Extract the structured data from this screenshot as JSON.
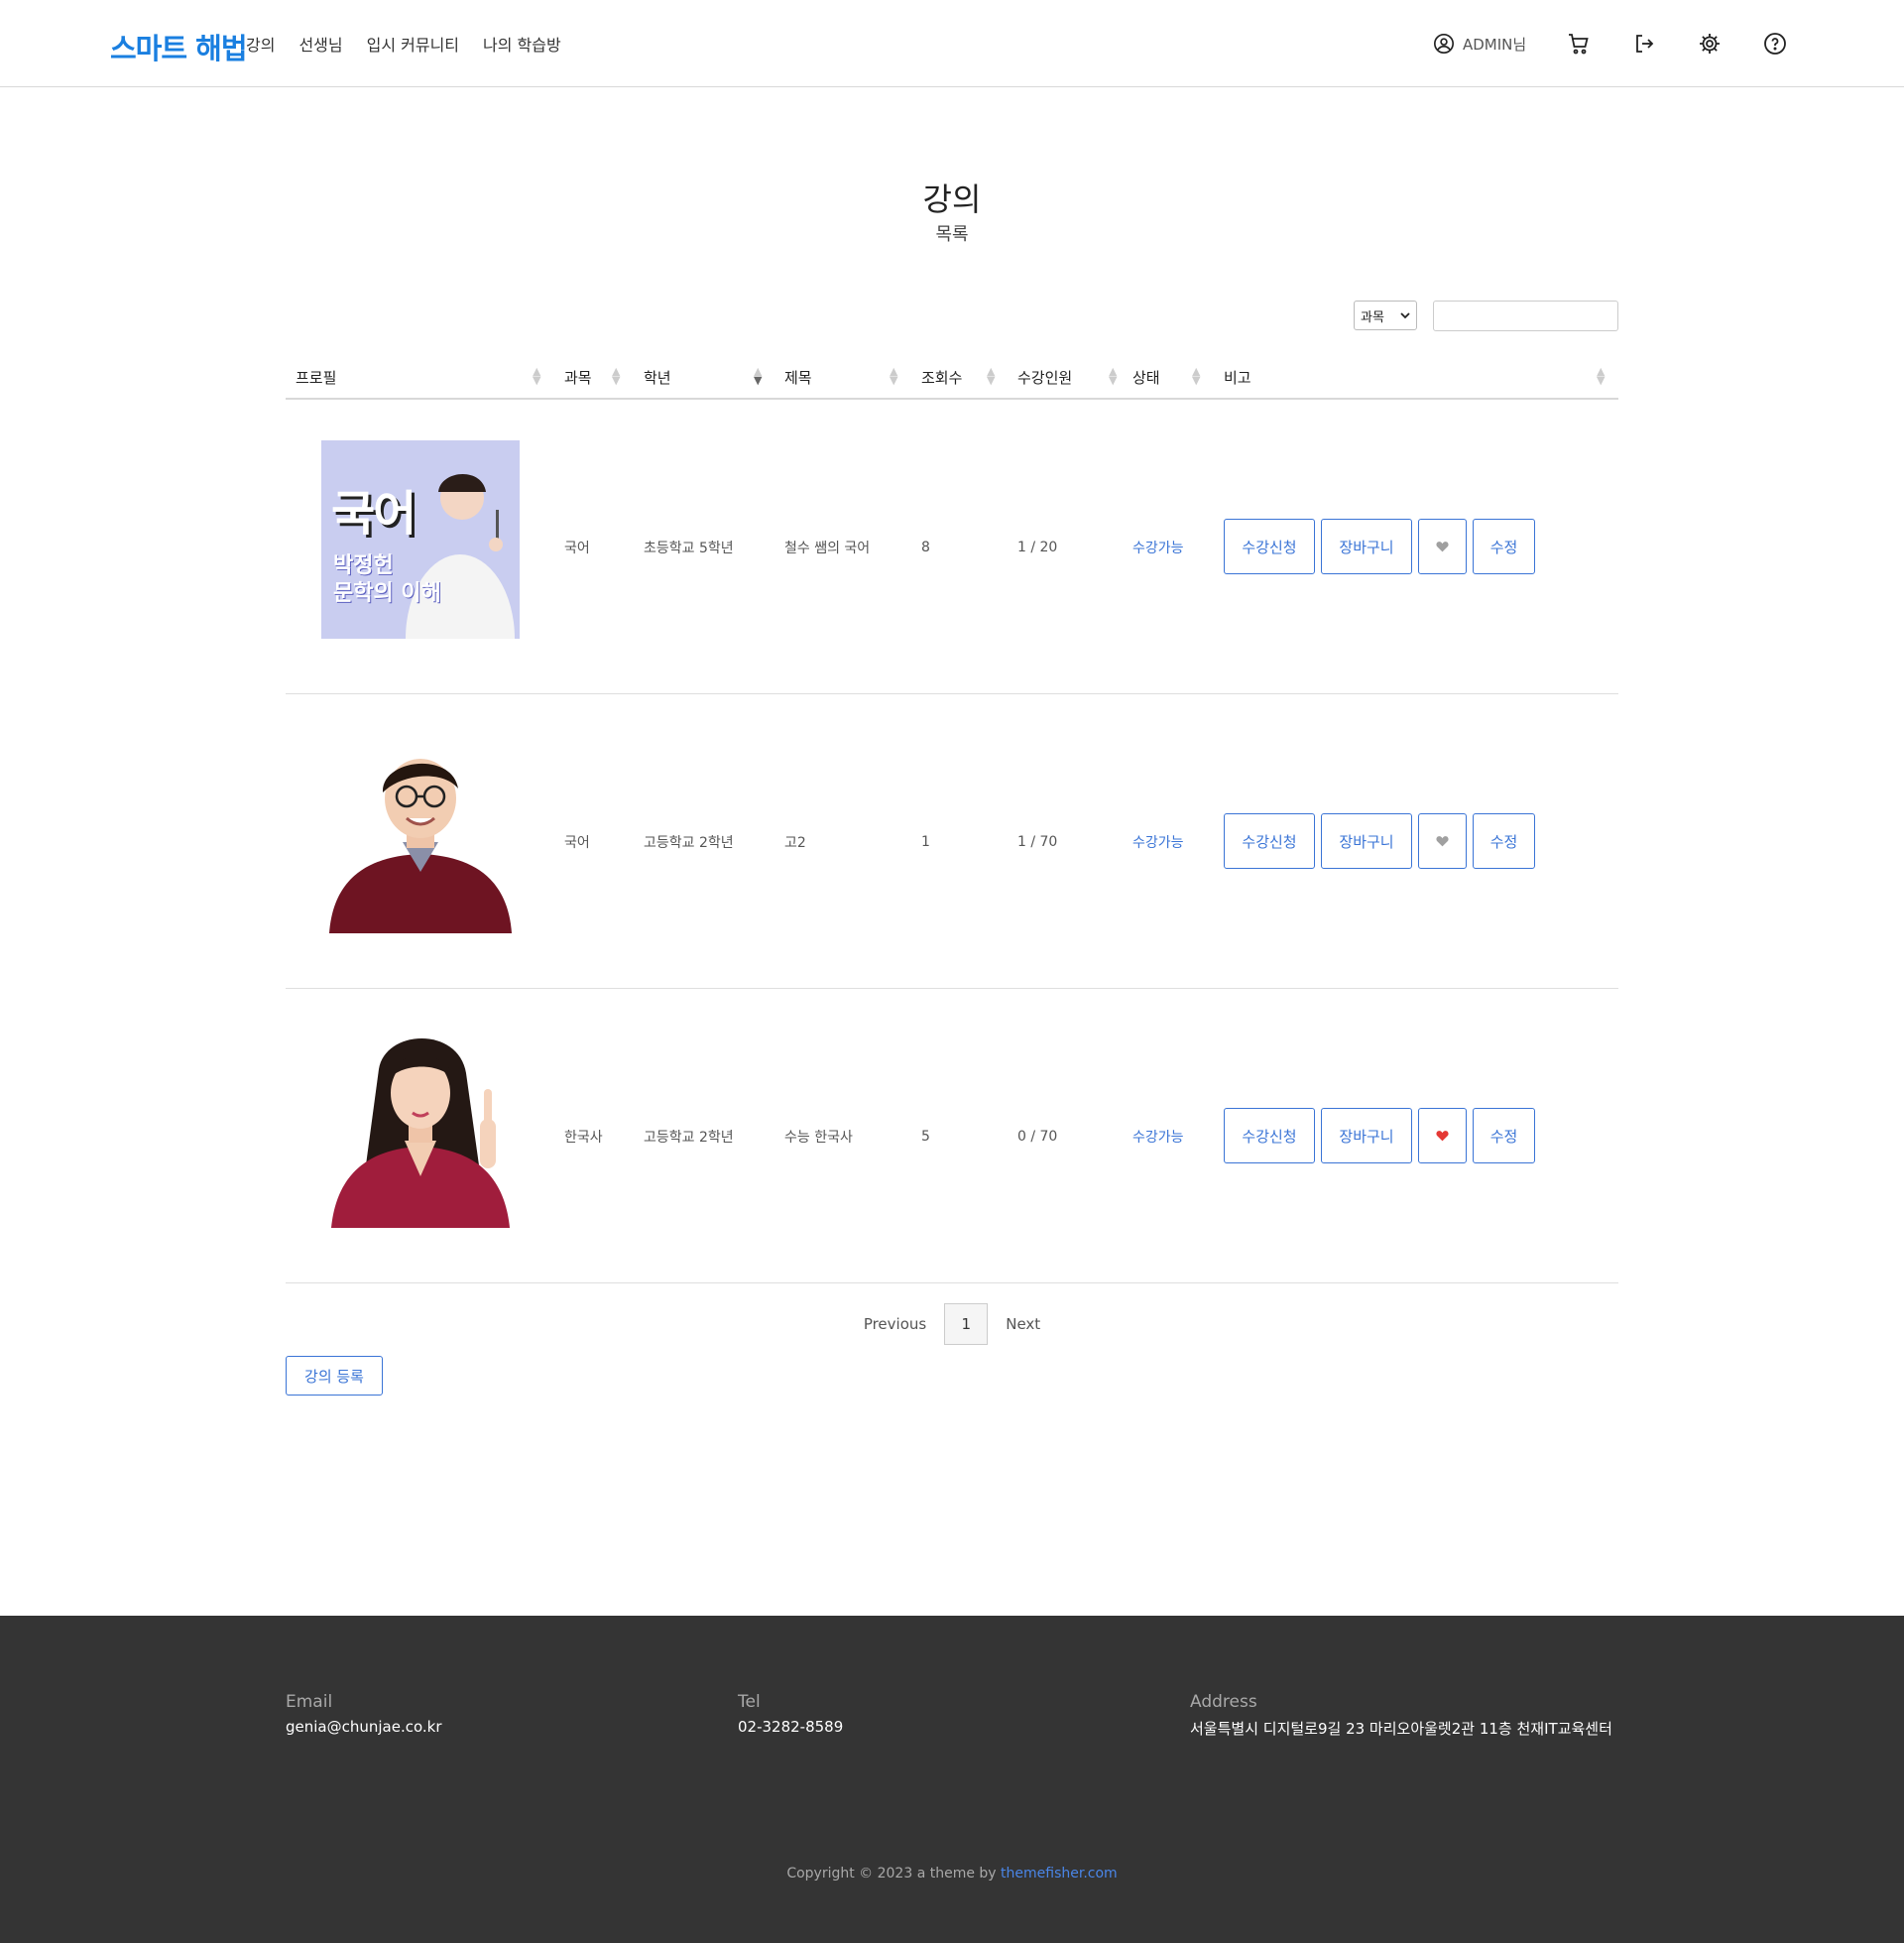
{
  "header": {
    "logo": "스마트 해법",
    "nav": [
      "강의",
      "선생님",
      "입시 커뮤니티",
      "나의 학습방"
    ],
    "user": "ADMIN님"
  },
  "page": {
    "title": "강의",
    "subtitle": "목록"
  },
  "search": {
    "filter_selected": "과목",
    "query": ""
  },
  "table": {
    "headers": [
      "프로필",
      "과목",
      "학년",
      "제목",
      "조회수",
      "수강인원",
      "상태",
      "비고"
    ],
    "rows": [
      {
        "subject": "국어",
        "grade": "초등학교 5학년",
        "title": "철수 쌤의 국어",
        "views": "8",
        "enrollment": "1 / 20",
        "status": "수강가능",
        "liked": false,
        "thumb": {
          "big": "국어",
          "line1": "박정헌",
          "line2": "문학의 이해"
        }
      },
      {
        "subject": "국어",
        "grade": "고등학교 2학년",
        "title": "고2",
        "views": "1",
        "enrollment": "1 / 70",
        "status": "수강가능",
        "liked": false
      },
      {
        "subject": "한국사",
        "grade": "고등학교 2학년",
        "title": "수능 한국사",
        "views": "5",
        "enrollment": "0 / 70",
        "status": "수강가능",
        "liked": true
      }
    ],
    "actions": {
      "enroll": "수강신청",
      "cart": "장바구니",
      "edit": "수정"
    }
  },
  "pagination": {
    "previous": "Previous",
    "current": "1",
    "next": "Next"
  },
  "register_button": "강의 등록",
  "footer": {
    "email_label": "Email",
    "email": "genia@chunjae.co.kr",
    "tel_label": "Tel",
    "tel": "02-3282-8589",
    "address_label": "Address",
    "address": "서울특별시 디지털로9길 23 마리오아울렛2관 11층 천재IT교육센터",
    "copyright_prefix": "Copyright © 2023 a theme by ",
    "copyright_link": "themefisher.com"
  },
  "colors": {
    "accent": "#3a74d6",
    "logo": "#1a7fe0",
    "footer_bg": "#343434",
    "heart_on": "#e53935",
    "heart_off": "#a0a0a0"
  }
}
